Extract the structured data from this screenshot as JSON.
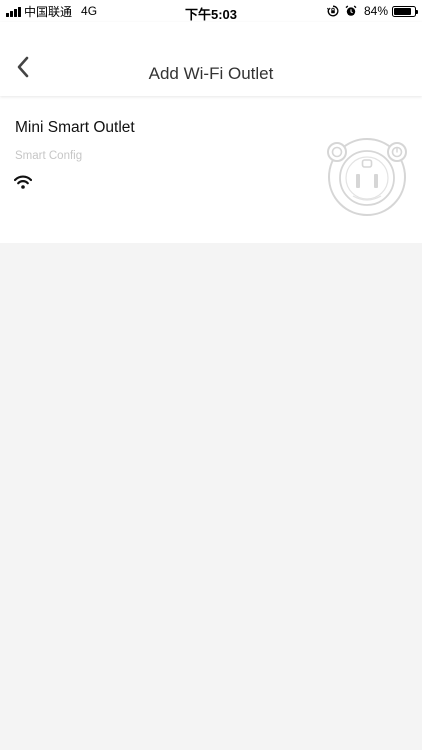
{
  "status_bar": {
    "carrier": "中国联通",
    "network": "4G",
    "time": "下午5:03",
    "battery_percent": "84%",
    "battery_level": 0.84,
    "icons": [
      "signal-icon",
      "rotation-lock-icon",
      "alarm-icon",
      "battery-icon"
    ]
  },
  "nav": {
    "title": "Add Wi-Fi Outlet",
    "back_icon": "chevron-left-icon"
  },
  "device": {
    "name": "Mini Smart Outlet",
    "mode": "Smart Config",
    "icons": [
      "wifi-icon",
      "smart-outlet-icon"
    ]
  },
  "colors": {
    "background": "#f4f4f4",
    "card": "#ffffff",
    "subtext": "#c6c6c6",
    "illustration": "#d6d6d6"
  }
}
